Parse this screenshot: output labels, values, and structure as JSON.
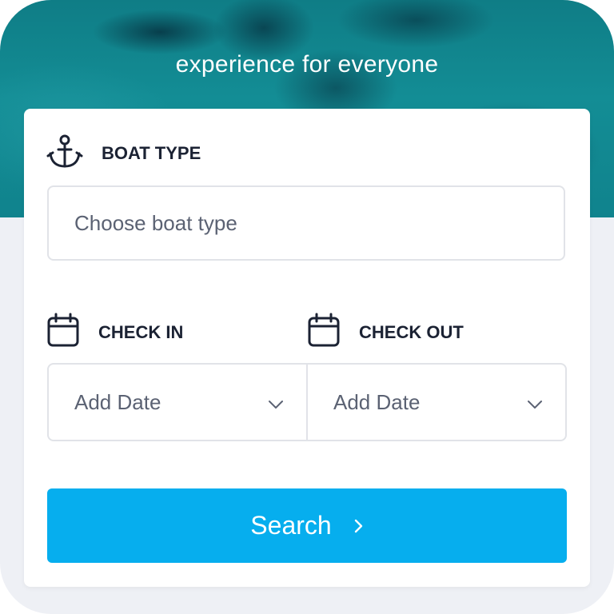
{
  "hero": {
    "title": "experience for everyone"
  },
  "form": {
    "boat_type": {
      "label": "BOAT TYPE",
      "placeholder": "Choose boat type",
      "icon": "anchor-icon"
    },
    "check_in": {
      "label": "CHECK IN",
      "value": "Add Date",
      "icon": "calendar-icon"
    },
    "check_out": {
      "label": "CHECK OUT",
      "value": "Add Date",
      "icon": "calendar-icon"
    },
    "search_label": "Search"
  },
  "colors": {
    "accent": "#06aeee",
    "label_text": "#1b2233",
    "placeholder_text": "#5b6273",
    "background": "#eef0f5"
  }
}
